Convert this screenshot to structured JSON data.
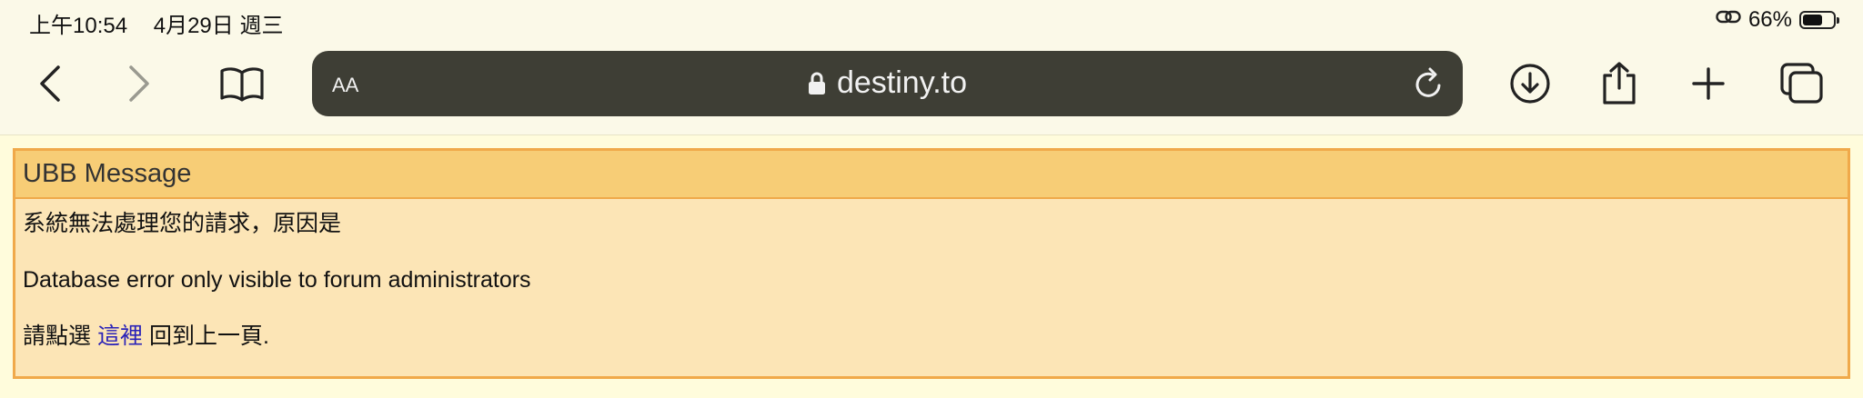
{
  "status_bar": {
    "time": "上午10:54",
    "date": "4月29日 週三",
    "battery": "66%",
    "battery_level": 0.66
  },
  "toolbar": {
    "reader_label": "AA",
    "url": "destiny.to",
    "icons": [
      "back-icon",
      "forward-icon",
      "bookmarks-icon",
      "lock-icon",
      "reload-icon",
      "download-icon",
      "share-icon",
      "new-tab-icon",
      "tabs-icon"
    ]
  },
  "message": {
    "title": "UBB Message",
    "line1": "系統無法處理您的請求，原因是",
    "line2": "Database error only visible to forum administrators",
    "line3_prefix": "請點選",
    "line3_link": "這裡",
    "line3_suffix": "回到上一頁."
  },
  "colors": {
    "page_bg": "#fffcdc",
    "url_bar_bg": "#3e3e35",
    "message_border": "#f0a94a",
    "message_header_bg": "#f7cd76",
    "message_body_bg": "#fce5b6",
    "link": "#2a22b8"
  }
}
